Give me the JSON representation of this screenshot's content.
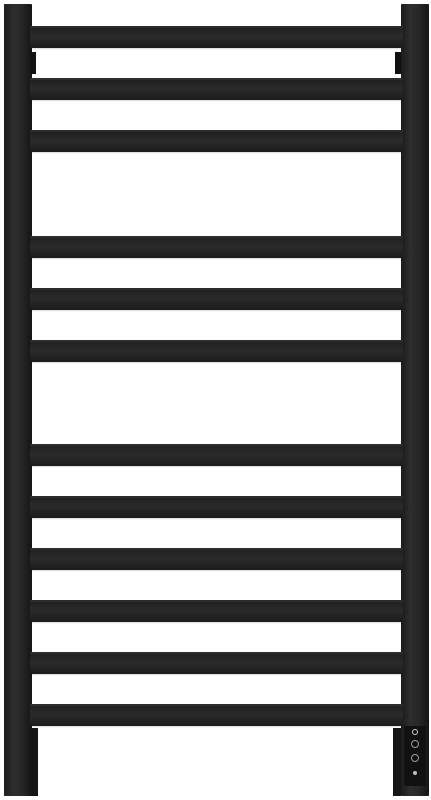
{
  "product": {
    "type": "heated towel rail",
    "finish_color": "#222222",
    "bar_count": 12,
    "bar_groups": [
      3,
      3,
      6
    ]
  }
}
